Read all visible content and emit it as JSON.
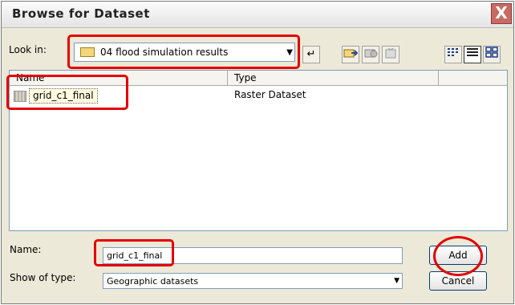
{
  "dialog": {
    "title": "Browse for Dataset",
    "close_label": "X"
  },
  "lookin": {
    "label": "Look in:",
    "value": "04 flood simulation results"
  },
  "toolbar": {
    "icons": [
      "up-one-level-icon",
      "connect-folder-icon",
      "disconnect-folder-icon",
      "new-item-icon",
      "list-view-icon",
      "details-view-icon",
      "thumbnails-view-icon"
    ]
  },
  "list": {
    "columns": [
      "Name",
      "Type"
    ],
    "rows": [
      {
        "name": "grid_c1_final",
        "type": "Raster Dataset"
      }
    ]
  },
  "name_field": {
    "label": "Name:",
    "value": "grid_c1_final"
  },
  "type_field": {
    "label": "Show of type:",
    "value": "Geographic datasets"
  },
  "buttons": {
    "add": "Add",
    "cancel": "Cancel"
  },
  "colors": {
    "annotation": "#e40000",
    "dialog_bg": "#ece9d8"
  }
}
